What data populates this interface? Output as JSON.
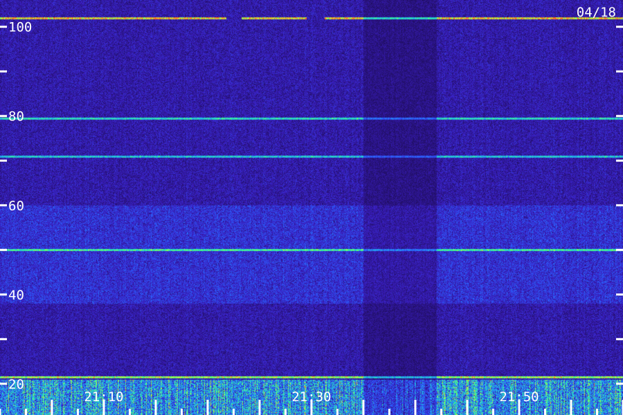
{
  "chart_data": {
    "type": "heatmap",
    "date_label": "04/18",
    "y_axis": {
      "ylim": [
        13,
        106
      ],
      "labeled_ticks": [
        100,
        80,
        60,
        40,
        20
      ],
      "tick_labels": [
        "100",
        "80",
        "60",
        "40",
        "20"
      ],
      "minor_ticks": [
        90,
        70,
        50,
        30
      ]
    },
    "x_axis": {
      "labeled_ticks": [
        "21:10",
        "21:30",
        "21:50"
      ],
      "tick_labels": [
        "21:10",
        "21:30",
        "21:50"
      ],
      "major_tick_minutes": [
        5,
        10,
        15,
        20,
        25,
        30,
        35,
        40,
        45,
        50,
        55,
        60
      ],
      "minor_tick_minutes": [
        0,
        2.5,
        7.5,
        12.5,
        17.5,
        22.5,
        27.5,
        32.5,
        37.5,
        42.5,
        47.5,
        52.5,
        57.5
      ],
      "start_time": "21:00",
      "end_time": "22:00"
    },
    "colormap": [
      "#1a0a4a",
      "#3a1ec0",
      "#2a60ff",
      "#20c8e0",
      "#40ff80",
      "#c8ff40",
      "#ff6020"
    ],
    "background_color": "#221050",
    "features": [
      {
        "type": "line",
        "freq": 102,
        "intensity": 0.85,
        "gaps": [
          [
            21.75,
            23.25
          ],
          [
            29.5,
            31.25
          ]
        ]
      },
      {
        "type": "line",
        "freq": 79.5,
        "intensity": 0.45
      },
      {
        "type": "line",
        "freq": 71,
        "intensity": 0.4
      },
      {
        "type": "line",
        "freq": 50,
        "intensity": 0.45
      },
      {
        "type": "line",
        "freq": 21.5,
        "intensity": 0.7
      },
      {
        "type": "band",
        "freq_range": [
          38,
          60
        ],
        "intensity": 0.25
      },
      {
        "type": "noise_band",
        "freq_range": [
          13,
          21
        ],
        "intensity": 0.75
      },
      {
        "type": "quiet_column",
        "time_range": [
          35,
          42
        ]
      }
    ]
  }
}
